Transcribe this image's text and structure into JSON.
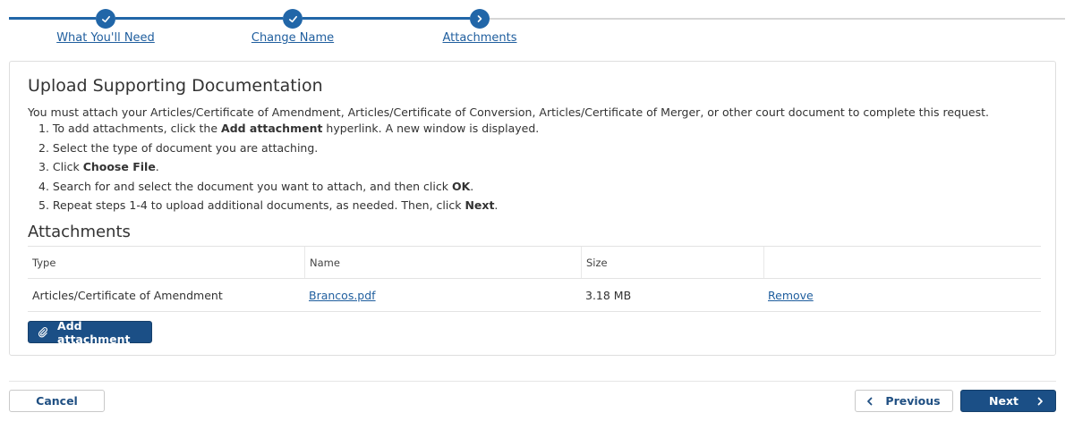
{
  "stepper": {
    "steps": [
      {
        "label": "What You'll Need",
        "status": "complete"
      },
      {
        "label": "Change Name",
        "status": "complete"
      },
      {
        "label": "Attachments",
        "status": "current"
      }
    ]
  },
  "content": {
    "title": "Upload Supporting Documentation",
    "intro": "You must attach your Articles/Certificate of Amendment, Articles/Certificate of Conversion, Articles/Certificate of Merger, or other court document to complete this request.",
    "instructions": [
      {
        "num": "1.",
        "pre": "To add attachments, click the ",
        "bold": "Add attachment",
        "post": " hyperlink. A new window is displayed."
      },
      {
        "num": "2.",
        "pre": "Select the type of document you are attaching.",
        "bold": "",
        "post": ""
      },
      {
        "num": "3.",
        "pre": "Click ",
        "bold": "Choose File",
        "post": "."
      },
      {
        "num": "4.",
        "pre": "Search for and select the document you want to attach, and then click ",
        "bold": "OK",
        "post": "."
      },
      {
        "num": "5.",
        "pre": "Repeat steps 1-4 to upload additional documents, as needed. Then, click ",
        "bold": "Next",
        "post": "."
      }
    ]
  },
  "attachments": {
    "heading": "Attachments",
    "columns": [
      "Type",
      "Name",
      "Size",
      ""
    ],
    "rows": [
      {
        "type": "Articles/Certificate of Amendment",
        "name": "Brancos.pdf",
        "size": "3.18 MB",
        "action": "Remove"
      }
    ],
    "add_label": "Add attachment"
  },
  "footer": {
    "cancel_label": "Cancel",
    "previous_label": "Previous",
    "next_label": "Next"
  },
  "colors": {
    "primary": "#1b4f86",
    "link": "#1f5e9e",
    "stepper_active": "#2166a8",
    "stepper_inactive": "#d6d6d6"
  },
  "icons": {
    "step_complete": "check-icon",
    "step_current": "chevron-right-icon",
    "add": "paperclip-icon",
    "previous": "chevron-left-icon",
    "next": "chevron-right-icon"
  }
}
